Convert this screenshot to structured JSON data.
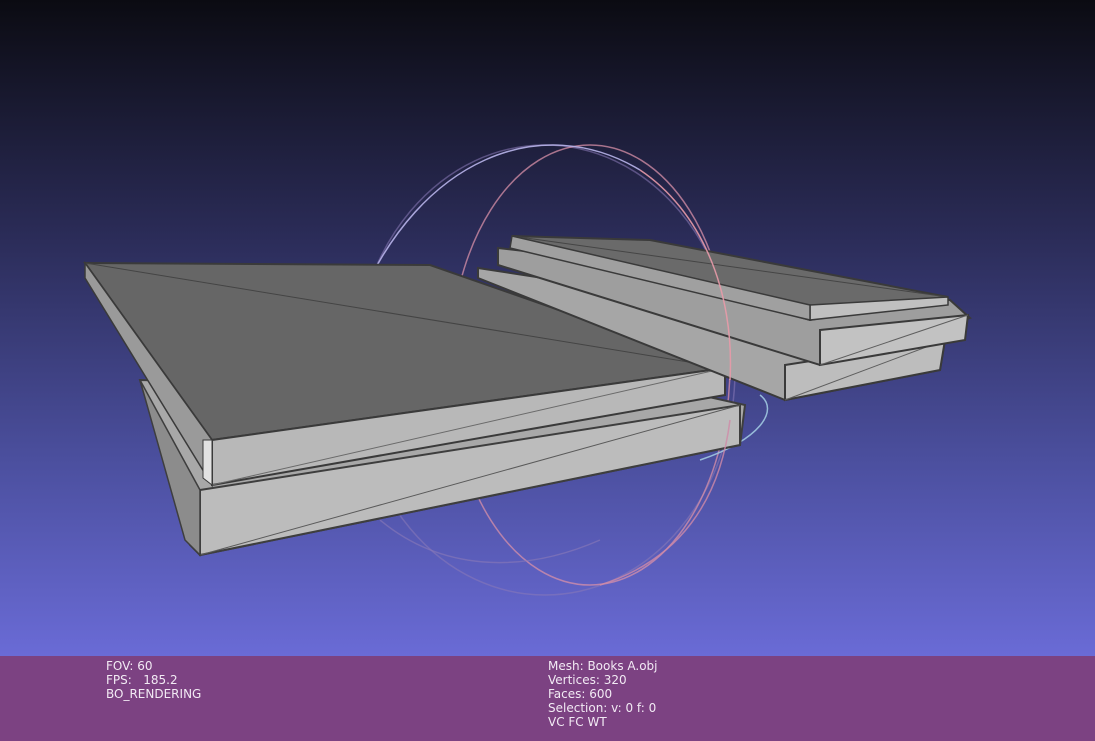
{
  "viewer": {
    "colors": {
      "background_top": "#0b0b12",
      "background_bottom": "#6a6bd6",
      "status_bar": "#7c4282",
      "status_text": "#f2eaf4",
      "mesh_face": "#6a6a6a",
      "mesh_side": "#b4b4b4",
      "trackball_red": "#e89aa8",
      "trackball_blue": "#a8a8e8"
    }
  },
  "status": {
    "left": {
      "fov": "FOV: 60",
      "fps": "FPS:   185.2",
      "render_mode": "BO_RENDERING"
    },
    "right": {
      "mesh": "Mesh: Books A.obj",
      "vertices": "Vertices: 320",
      "faces": "Faces: 600",
      "selection": "Selection: v: 0 f: 0",
      "flags": "VC FC WT"
    }
  }
}
